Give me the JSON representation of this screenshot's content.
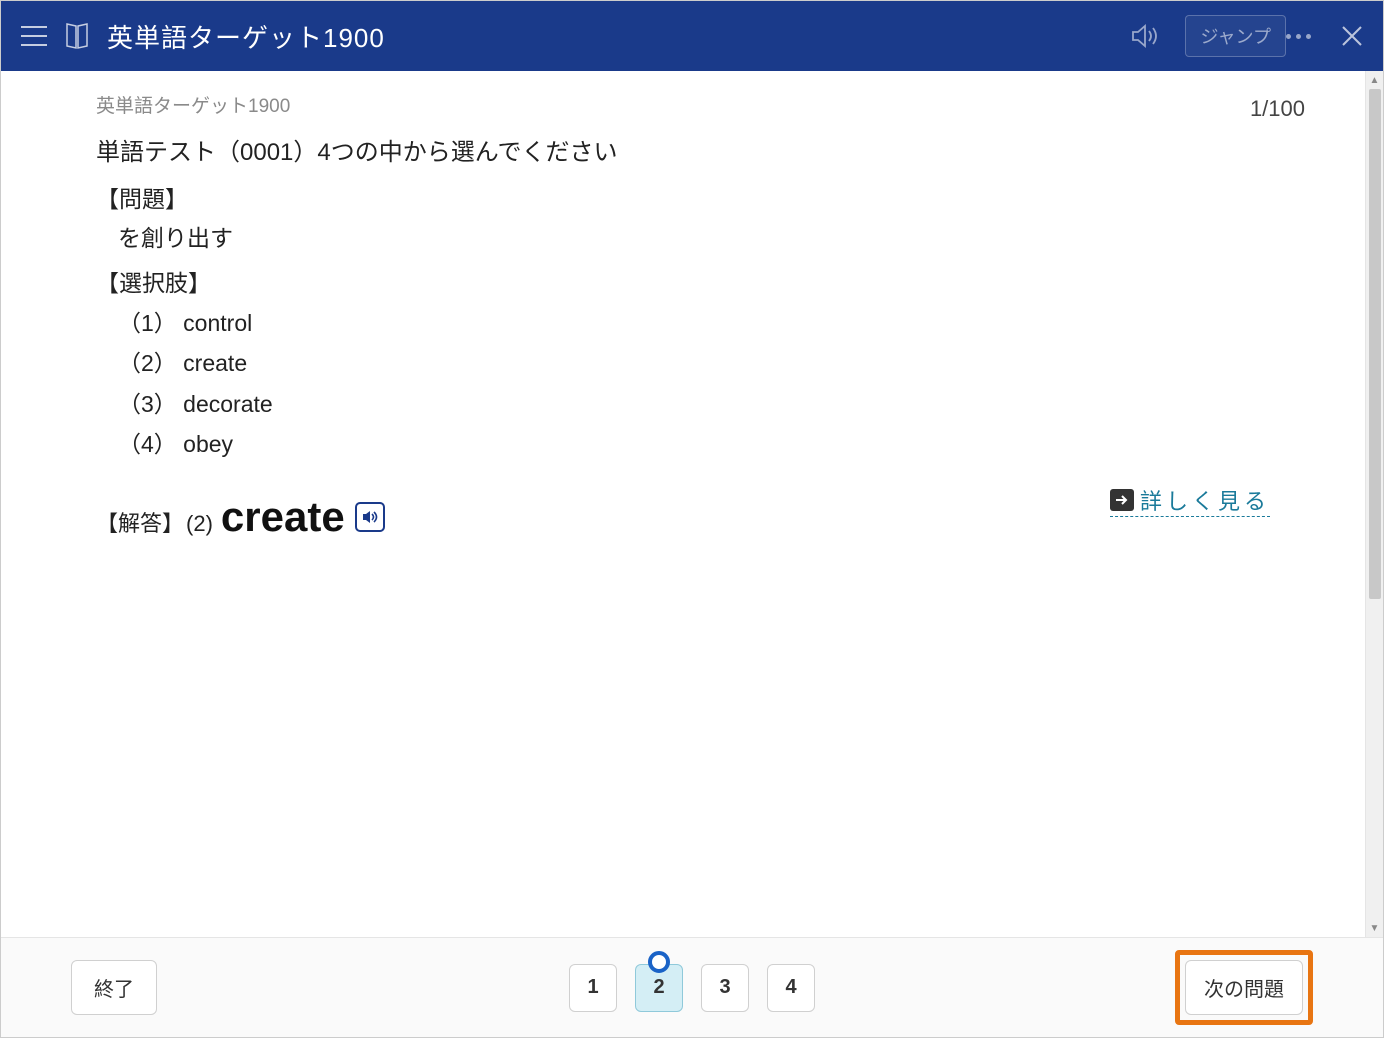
{
  "header": {
    "title": "英単語ターゲット1900",
    "jump_label": "ジャンプ"
  },
  "page": {
    "counter": "1/100",
    "breadcrumb": "英単語ターゲット1900",
    "test_title": "単語テスト（0001）4つの中から選んでください",
    "question_label": "【問題】",
    "question_text": "を創り出す",
    "choices_label": "【選択肢】",
    "choices": [
      "（1） control",
      "（2） create",
      "（3） decorate",
      "（4） obey"
    ],
    "answer_label": "【解答】",
    "answer_number": "(2)",
    "answer_word": "create",
    "detail_link": "詳しく見る"
  },
  "footer": {
    "exit_label": "終了",
    "next_label": "次の問題",
    "buttons": [
      "1",
      "2",
      "3",
      "4"
    ],
    "selected_index": 1
  }
}
